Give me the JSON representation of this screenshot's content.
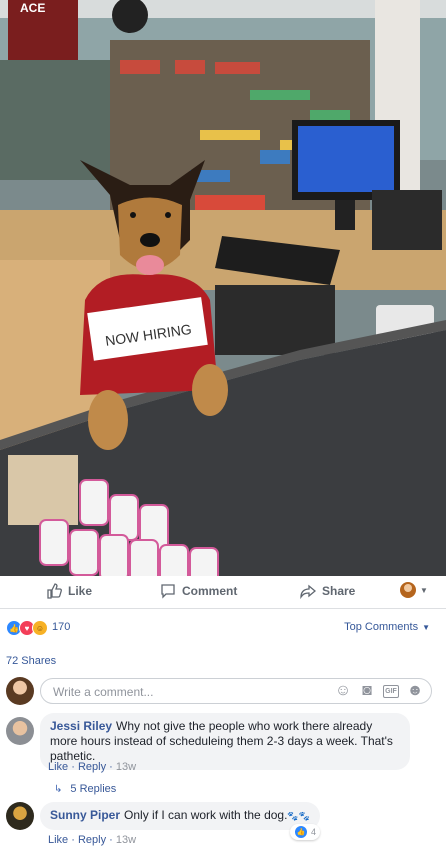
{
  "photo": {
    "sign_text": "NOW HIRING",
    "store_sign": "ACE",
    "alt": ""
  },
  "actions": {
    "like_label": "Like",
    "comment_label": "Comment",
    "share_label": "Share"
  },
  "reactions": {
    "count": "170",
    "top_comments_label": "Top Comments",
    "icons": [
      "like-icon",
      "love-icon",
      "haha-icon"
    ]
  },
  "shares_label": "72 Shares",
  "write_comment": {
    "placeholder": "Write a comment..."
  },
  "comments": [
    {
      "author": "Jessi Riley",
      "text": "Why not give the people who work there already more hours instead of scheduleing them 2-3 days a week. That's pathetic.",
      "like_label": "Like",
      "reply_label": "Reply",
      "time": "13w",
      "replies_label": "5 Replies"
    },
    {
      "author": "Sunny Piper",
      "text": "Only if I can work with the dog.",
      "like_label": "Like",
      "reply_label": "Reply",
      "time": "13w",
      "like_count": "4"
    }
  ],
  "colors": {
    "link_blue": "#385898",
    "facebook_blue": "#4267b2",
    "like_blue": "#2d88ff",
    "love_red": "#f33e58"
  }
}
